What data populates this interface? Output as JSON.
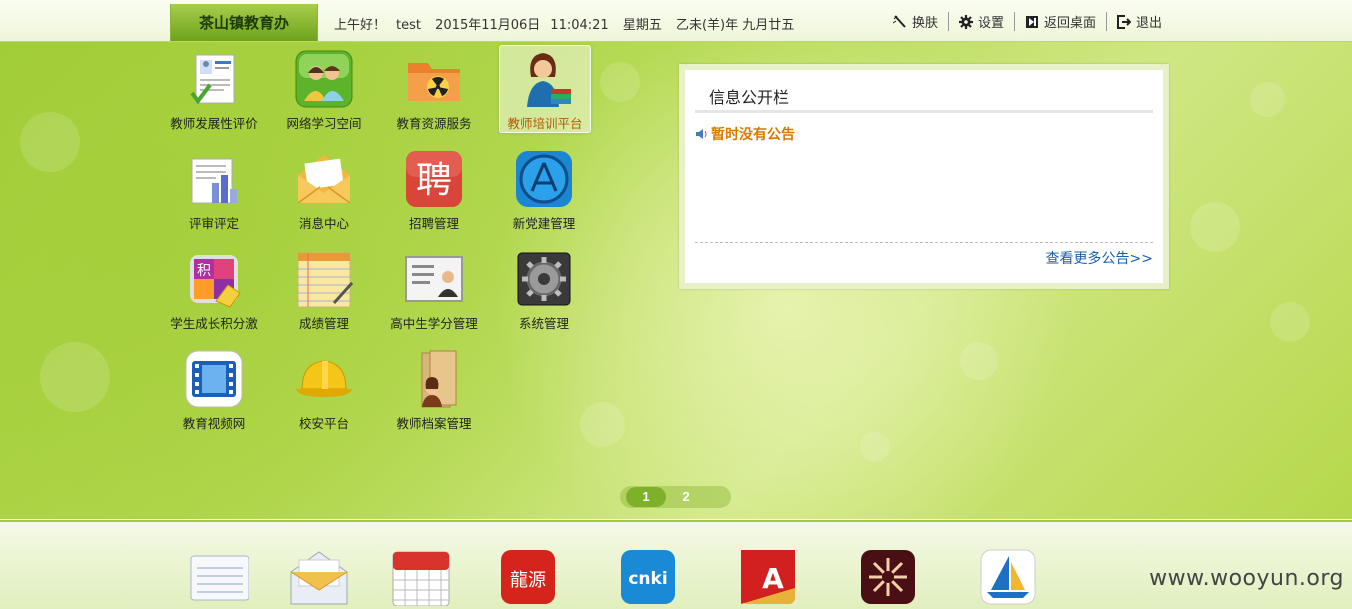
{
  "topbar": {
    "unit_name": "茶山镇教育办",
    "greeting": "上午好！",
    "user": "test",
    "date": "2015年11月06日",
    "time": "11:04:21",
    "weekday": "星期五",
    "lunar": "乙未(羊)年 九月廿五",
    "tools": [
      {
        "label": "换肤",
        "icon": "skin-brush-icon"
      },
      {
        "label": "设置",
        "icon": "gear-icon"
      },
      {
        "label": "返回桌面",
        "icon": "return-desktop-icon"
      },
      {
        "label": "退出",
        "icon": "logout-icon"
      }
    ]
  },
  "apps": [
    {
      "label": "教师发展性评价",
      "icon": "teacher-evaluation-icon"
    },
    {
      "label": "网络学习空间",
      "icon": "learning-space-icon"
    },
    {
      "label": "教育资源服务",
      "icon": "resource-folder-icon"
    },
    {
      "label": "教师培训平台",
      "icon": "teacher-training-icon"
    },
    {
      "label": "评审评定",
      "icon": "review-chart-icon"
    },
    {
      "label": "消息中心",
      "icon": "envelope-icon"
    },
    {
      "label": "招聘管理",
      "icon": "recruit-icon",
      "glyph": "聘"
    },
    {
      "label": "新党建管理",
      "icon": "app-store-icon"
    },
    {
      "label": "学生成长积分激",
      "icon": "growth-points-icon",
      "glyph": "积"
    },
    {
      "label": "成绩管理",
      "icon": "score-notepad-icon"
    },
    {
      "label": "高中生学分管理",
      "icon": "student-card-icon"
    },
    {
      "label": "系统管理",
      "icon": "system-gear-icon"
    },
    {
      "label": "教育视频网",
      "icon": "video-film-icon"
    },
    {
      "label": "校安平台",
      "icon": "safety-helmet-icon"
    },
    {
      "label": "教师档案管理",
      "icon": "teacher-archive-icon"
    }
  ],
  "notice": {
    "title": "信息公开栏",
    "empty_message": "暂时没有公告",
    "more_link": "查看更多公告>>"
  },
  "pager": {
    "pages": [
      "1",
      "2"
    ],
    "current": "1"
  },
  "dock": [
    {
      "icon": "notepad-icon"
    },
    {
      "icon": "mail-icon"
    },
    {
      "icon": "calendar-icon"
    },
    {
      "icon": "longyuan-icon",
      "glyph": "龍源"
    },
    {
      "icon": "cnki-icon",
      "glyph": "cnki"
    },
    {
      "icon": "huiya-icon",
      "glyph": "A"
    },
    {
      "icon": "sun-logo-icon"
    },
    {
      "icon": "sailboat-icon"
    }
  ],
  "watermark": "www.wooyun.org"
}
